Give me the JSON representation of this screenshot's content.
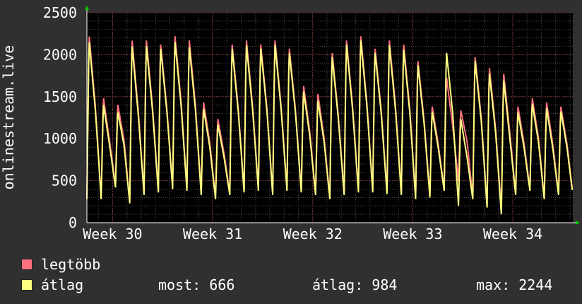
{
  "chart_data": {
    "type": "line",
    "ylabel": "onlinestream.live",
    "ylim": [
      0,
      2500
    ],
    "yticks": [
      0,
      500,
      1000,
      1500,
      2000,
      2500
    ],
    "x_tick_labels": [
      "Week 30",
      "Week 31",
      "Week 32",
      "Week 33",
      "Week 34"
    ],
    "x_tick_positions": [
      3.0,
      10.0,
      17.0,
      24.0,
      31.0
    ],
    "x_range": [
      1.2,
      35.2
    ],
    "grid": true,
    "colors": {
      "background": "#303030",
      "plot": "#000000",
      "grid": "#5a2a2a",
      "axis": "#ffffff",
      "arrow": "#00cc00"
    },
    "series": [
      {
        "name": "legtöbb",
        "color": "#ff7080",
        "day_values": [
          [
            300,
            2250
          ],
          [
            300,
            1500
          ],
          [
            450,
            1420
          ],
          [
            250,
            2200
          ],
          [
            350,
            2200
          ],
          [
            380,
            2150
          ],
          [
            420,
            2250
          ],
          [
            400,
            2200
          ],
          [
            350,
            1450
          ],
          [
            300,
            1250
          ],
          [
            350,
            2150
          ],
          [
            380,
            2200
          ],
          [
            400,
            2150
          ],
          [
            350,
            2200
          ],
          [
            400,
            2100
          ],
          [
            380,
            1650
          ],
          [
            350,
            1550
          ],
          [
            300,
            2050
          ],
          [
            350,
            2200
          ],
          [
            380,
            2250
          ],
          [
            380,
            2100
          ],
          [
            360,
            2200
          ],
          [
            350,
            2150
          ],
          [
            300,
            1950
          ],
          [
            320,
            1400
          ],
          [
            400,
            1750
          ],
          [
            500,
            1350
          ],
          [
            300,
            2000
          ],
          [
            200,
            1870
          ],
          [
            150,
            1800
          ],
          [
            350,
            1400
          ],
          [
            400,
            1500
          ],
          [
            300,
            1450
          ],
          [
            350,
            1400
          ]
        ]
      },
      {
        "name": "átlag",
        "color": "#ffff80",
        "day_values": [
          [
            280,
            2180
          ],
          [
            280,
            1420
          ],
          [
            420,
            1330
          ],
          [
            230,
            2130
          ],
          [
            330,
            2130
          ],
          [
            360,
            2100
          ],
          [
            400,
            2180
          ],
          [
            380,
            2120
          ],
          [
            330,
            1370
          ],
          [
            280,
            1180
          ],
          [
            330,
            2100
          ],
          [
            360,
            2140
          ],
          [
            380,
            2100
          ],
          [
            330,
            2150
          ],
          [
            380,
            2050
          ],
          [
            360,
            1580
          ],
          [
            330,
            1470
          ],
          [
            280,
            2000
          ],
          [
            330,
            2150
          ],
          [
            360,
            2200
          ],
          [
            360,
            2050
          ],
          [
            340,
            2140
          ],
          [
            330,
            2090
          ],
          [
            280,
            1900
          ],
          [
            300,
            1340
          ],
          [
            380,
            2050
          ],
          [
            200,
            1250
          ],
          [
            280,
            1950
          ],
          [
            180,
            1800
          ],
          [
            100,
            1720
          ],
          [
            330,
            1330
          ],
          [
            380,
            1430
          ],
          [
            280,
            1380
          ],
          [
            330,
            1340
          ]
        ]
      }
    ],
    "stats": {
      "now_label": "most:",
      "now_value": "666",
      "avg_label": "átlag:",
      "avg_value": "984",
      "max_label": "max:",
      "max_value": "2244"
    }
  }
}
